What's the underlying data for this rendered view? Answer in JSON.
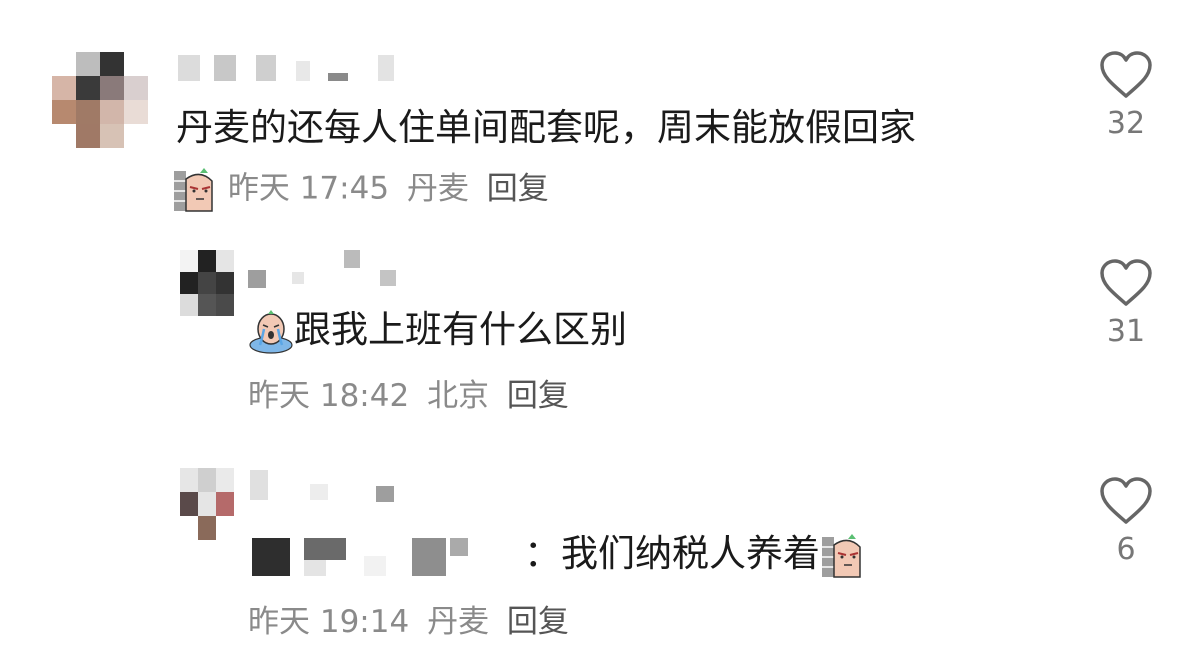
{
  "comments": [
    {
      "text": "丹麦的还每人住单间配套呢，周末能放假回家",
      "time": "昨天 17:45",
      "location": "丹麦",
      "reply_label": "回复",
      "likes": "32"
    },
    {
      "text": "跟我上班有什么区别",
      "time": "昨天 18:42",
      "location": "北京",
      "reply_label": "回复",
      "likes": "31"
    },
    {
      "text": "：我们纳税人养着",
      "time": "昨天 19:14",
      "location": "丹麦",
      "reply_label": "回复",
      "likes": "6"
    }
  ],
  "icons": {
    "like": "heart-outline-icon",
    "sticker_peek": "peeking-wall-sticker-icon",
    "sticker_cry": "crying-sticker-icon"
  },
  "colors": {
    "meta": "#8a8a8a",
    "text": "#1a1a1a",
    "heart": "#666666"
  }
}
